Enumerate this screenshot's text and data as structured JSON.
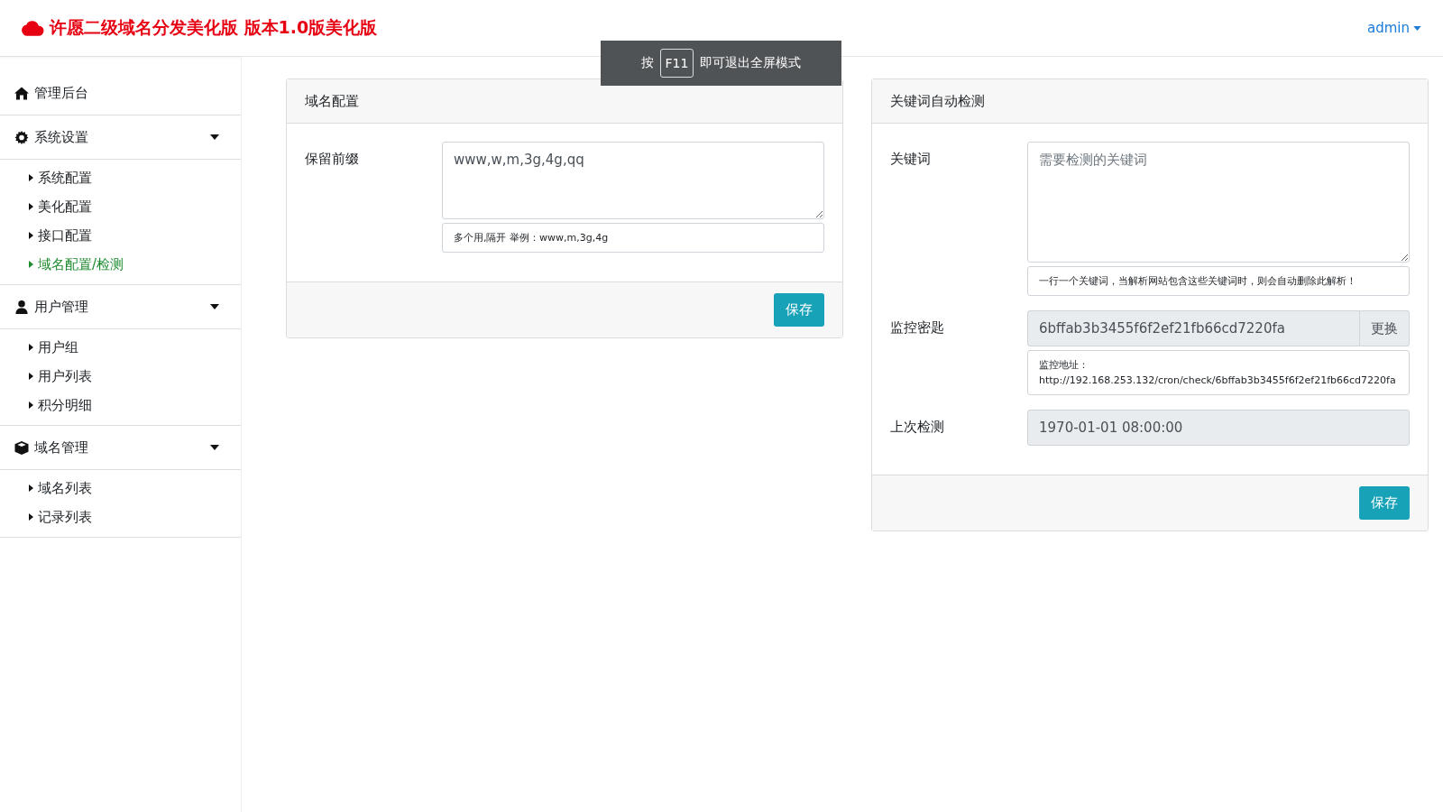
{
  "header": {
    "title": "许愿二级域名分发美化版 版本1.0版美化版",
    "user": "admin"
  },
  "toast": {
    "prefix": "按",
    "key": "F11",
    "suffix": "即可退出全屏模式"
  },
  "sidebar": {
    "items": [
      {
        "label": "管理后台"
      },
      {
        "label": "系统设置",
        "expanded": true,
        "children": [
          {
            "label": "系统配置",
            "selected": false
          },
          {
            "label": "美化配置",
            "selected": false
          },
          {
            "label": "接口配置",
            "selected": false
          },
          {
            "label": "域名配置/检测",
            "selected": true
          }
        ]
      },
      {
        "label": "用户管理",
        "expanded": true,
        "children": [
          {
            "label": "用户组",
            "selected": false
          },
          {
            "label": "用户列表",
            "selected": false
          },
          {
            "label": "积分明细",
            "selected": false
          }
        ]
      },
      {
        "label": "域名管理",
        "expanded": true,
        "children": [
          {
            "label": "域名列表",
            "selected": false
          },
          {
            "label": "记录列表",
            "selected": false
          }
        ]
      }
    ]
  },
  "panels": [
    {
      "title": "域名配置",
      "fields": [
        {
          "kind": "textarea",
          "label": "保留前缀",
          "value": "www,w,m,3g,4g,qq",
          "help": [
            "多个用,隔开 举例：www,m,3g,4g"
          ]
        }
      ],
      "button": "保存"
    },
    {
      "title": "关键词自动检测",
      "fields": [
        {
          "kind": "textarea-tall",
          "label": "关键词",
          "placeholder": "需要检测的关键词",
          "help": [
            "一行一个关键词，当解析网站包含这些关键词时，则会自动删除此解析！"
          ]
        },
        {
          "kind": "readonly-button",
          "label": "监控密匙",
          "value": "6bffab3b3455f6f2ef21fb66cd7220fa",
          "button": "更换",
          "help": [
            "监控地址：",
            "http://192.168.253.132/cron/check/6bffab3b3455f6f2ef21fb66cd7220fa"
          ]
        },
        {
          "kind": "readonly",
          "label": "上次检测",
          "value": "1970-01-01 08:00:00"
        }
      ],
      "button": "保存"
    }
  ]
}
